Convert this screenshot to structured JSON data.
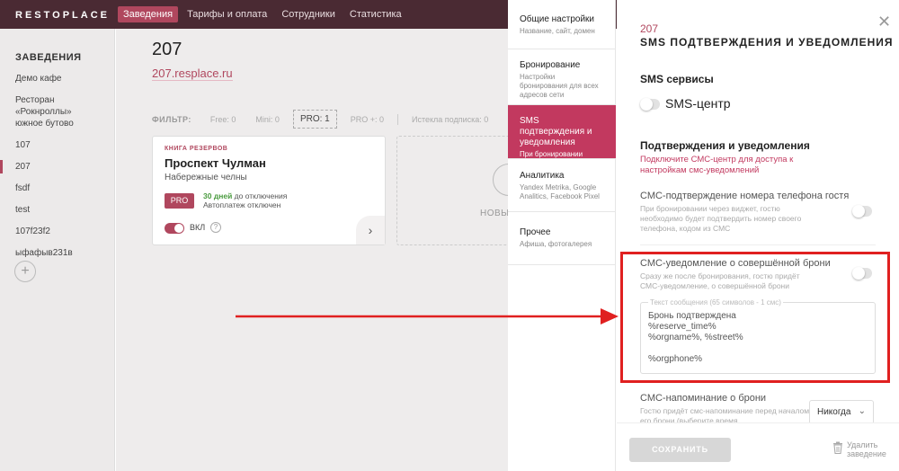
{
  "topbar": {
    "logo": "RESTOPLACE",
    "nav": [
      "Заведения",
      "Тарифы и оплата",
      "Сотрудники",
      "Статистика"
    ]
  },
  "sidebar": {
    "heading": "ЗАВЕДЕНИЯ",
    "venues": [
      "Демо кафе",
      "Ресторан «Рокнроллы» южное бутово",
      "107",
      "207",
      "fsdf",
      "test",
      "107f23f2",
      "ыфафыв231в"
    ],
    "active_venue": "207",
    "add_label": "+"
  },
  "main": {
    "title": "207",
    "link": "207.resplace.ru",
    "filter_label": "ФИЛЬТР:",
    "filters": [
      "Free: 0",
      "Mini: 0",
      "PRO: 1",
      "PRO +: 0",
      "Истекла подписка: 0",
      "Исте"
    ],
    "active_filter": "PRO: 1",
    "card": {
      "kicker": "КНИГА РЕЗЕРВОВ",
      "title": "Проспект Чулман",
      "subtitle": "Набережные челны",
      "plan": "PRO",
      "days_bold": "30 дней",
      "days_rest": " до отключения",
      "autopay": "Автоплатеж отключен",
      "toggle_label": "ВКЛ",
      "help": "?",
      "arrow": "›"
    },
    "add_card_label": "НОВЫ"
  },
  "settings_menu": [
    {
      "title": "Общие настройки",
      "sub": "Название, сайт, домен",
      "active": false
    },
    {
      "title": "Бронирование",
      "sub": "Настройки бронирования для всех адресов сети",
      "active": false
    },
    {
      "title": "SMS подтверждения и уведомления",
      "sub": "При бронировании",
      "active": true
    },
    {
      "title": "Аналитика",
      "sub": "Yandex Metrika, Google Analitics, Facebook Pixel",
      "active": false
    },
    {
      "title": "Прочее",
      "sub": "Афиша, фотогалерея",
      "active": false
    }
  ],
  "panel": {
    "number": "207",
    "title": "SMS ПОДТВЕРЖДЕНИЯ И УВЕДОМЛЕНИЯ",
    "close": "✕",
    "sms_services_title": "SMS сервисы",
    "sms_center_label": "SMS-центр",
    "confirmations_title": "Подтверждения и уведомления",
    "warning": "Подключите СМС-центр для доступа к настройкам смс-уведомлений",
    "options": [
      {
        "title": "СМС-подтверждение номера телефона гостя",
        "desc": "При бронировании через виджет, гостю необходимо будет подтвердить номер своего телефона, кодом из СМС"
      },
      {
        "title": "СМС-уведомление о совершённой брони",
        "desc": "Сразу же после бронирования, гостю придёт СМС-уведомление, о совершённой брони"
      },
      {
        "title": "СМС-напоминание о брони",
        "desc": "Гостю придёт смс-напоминание перед началом его брони (выберите время"
      }
    ],
    "message_legend": "Текст сообщения (65 символов - 1 смс)",
    "message_text": "Бронь подтверждена\n%reserve_time%\n%orgname%, %street%\n\n%orgphone%",
    "reminder_select": "Никогда",
    "save_label": "СОХРАНИТЬ",
    "delete_label": "Удалить заведение"
  },
  "colors": {
    "accent": "#c2395f",
    "topbar": "#4a2a33",
    "annotation": "#e02020"
  }
}
